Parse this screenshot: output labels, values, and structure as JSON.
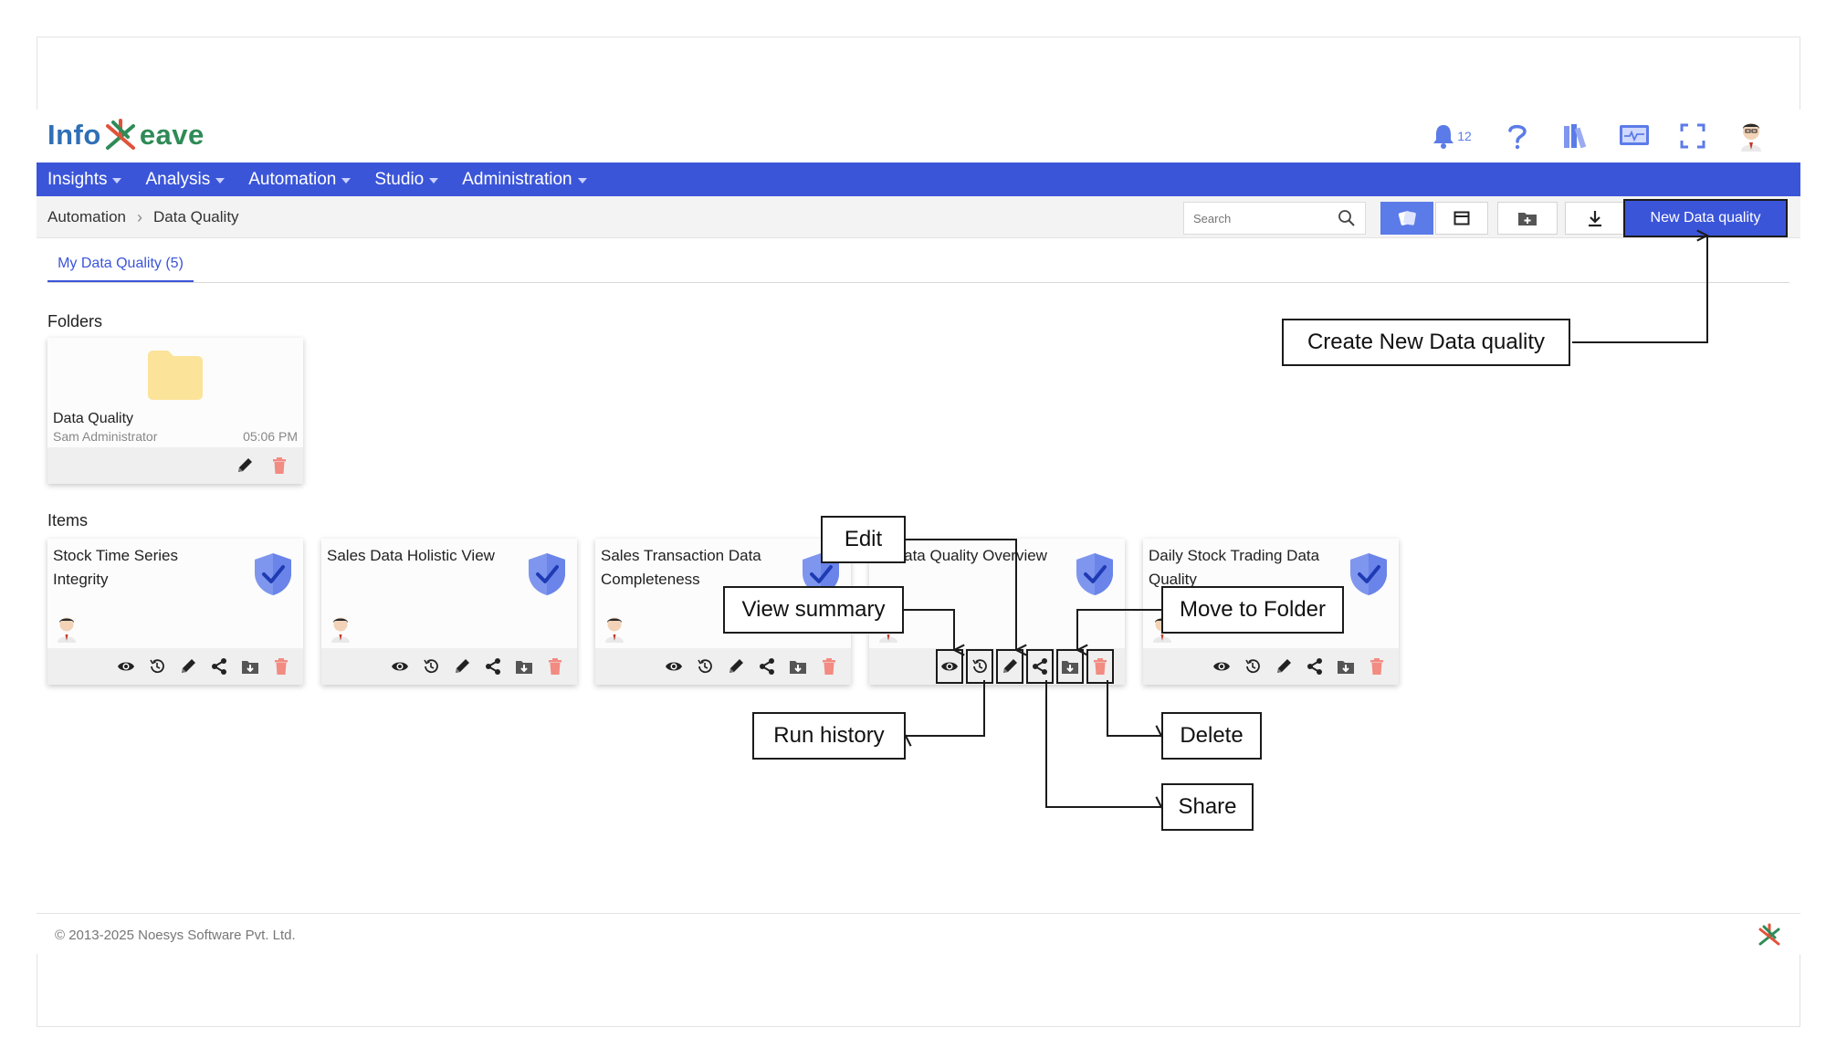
{
  "app": {
    "logo_left": "Info",
    "logo_right": "eave",
    "notification_count": "12"
  },
  "nav": {
    "items": [
      "Insights",
      "Analysis",
      "Automation",
      "Studio",
      "Administration"
    ]
  },
  "breadcrumb": [
    "Automation",
    "Data Quality"
  ],
  "toolbar": {
    "search_placeholder": "Search",
    "new_button": "New Data quality"
  },
  "tabs": [
    "My Data Quality (5)"
  ],
  "sections": {
    "folders": "Folders",
    "items": "Items"
  },
  "folder": {
    "name": "Data Quality",
    "owner": "Sam Administrator",
    "time": "05:06 PM"
  },
  "items": [
    {
      "title": "Stock Time Series Integrity"
    },
    {
      "title": "Sales Data Holistic View"
    },
    {
      "title": "Sales Transaction Data Completeness"
    },
    {
      "title": "er Data Quality Overview"
    },
    {
      "title": "Daily Stock Trading Data Quality"
    }
  ],
  "callouts": {
    "create_new": "Create New Data quality",
    "edit": "Edit",
    "view_summary": "View summary",
    "move_to_folder": "Move to Folder",
    "run_history": "Run history",
    "delete": "Delete",
    "share": "Share"
  },
  "footer": {
    "copyright": "© 2013-2025 Noesys Software Pvt. Ltd."
  },
  "colors": {
    "primary": "#3b55d9",
    "accent": "#5b7be8",
    "delete": "#f28b82"
  }
}
